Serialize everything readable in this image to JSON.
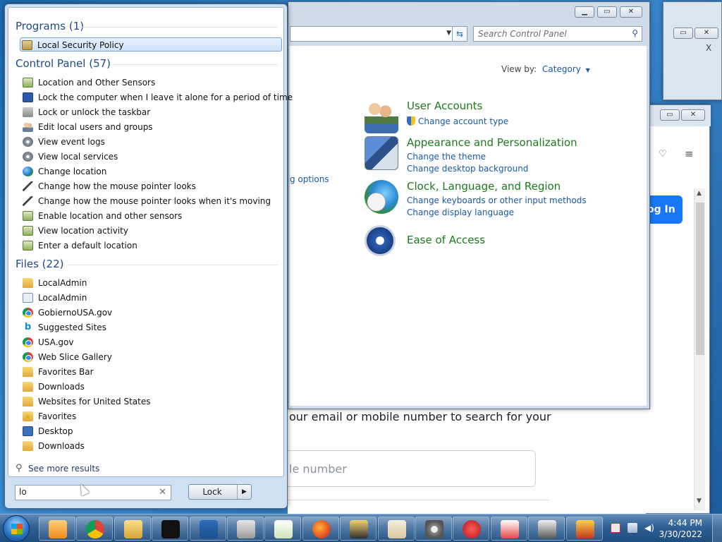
{
  "background_windows": {
    "browser": {
      "lines": [
        "our email or mobile number to search for your"
      ],
      "placeholder": "le number",
      "login_label": "og In"
    }
  },
  "control_panel": {
    "search_placeholder": "Search Control Panel",
    "view_by_label": "View by:",
    "view_by_value": "Category",
    "partial_link": "g options",
    "categories": [
      {
        "title": "User Accounts",
        "links": [
          "Change account type"
        ],
        "icon": "user-accounts-icon"
      },
      {
        "title": "Appearance and Personalization",
        "links": [
          "Change the theme",
          "Change desktop background"
        ],
        "icon": "appearance-icon"
      },
      {
        "title": "Clock, Language, and Region",
        "links": [
          "Change keyboards or other input methods",
          "Change display language"
        ],
        "icon": "clock-globe-icon"
      },
      {
        "title": "Ease of Access",
        "links": [],
        "icon": "ease-of-access-icon"
      }
    ]
  },
  "start_menu": {
    "programs_header": "Programs (1)",
    "programs": [
      {
        "label": "Local Security Policy",
        "icon": "security-policy-icon"
      }
    ],
    "control_panel_header": "Control Panel (57)",
    "control_panel_items": [
      {
        "label": "Location and Other Sensors",
        "icon": "sensors-icon"
      },
      {
        "label": "Lock the computer when I leave it alone for a period of time",
        "icon": "monitor-icon"
      },
      {
        "label": "Lock or unlock the taskbar",
        "icon": "taskbar-icon"
      },
      {
        "label": "Edit local users and groups",
        "icon": "users-icon"
      },
      {
        "label": "View event logs",
        "icon": "event-logs-icon"
      },
      {
        "label": "View local services",
        "icon": "services-icon"
      },
      {
        "label": "Change location",
        "icon": "globe-icon"
      },
      {
        "label": "Change how the mouse pointer looks",
        "icon": "pointer-icon"
      },
      {
        "label": "Change how the mouse pointer looks when it's moving",
        "icon": "pointer-icon"
      },
      {
        "label": "Enable location and other sensors",
        "icon": "sensors-icon"
      },
      {
        "label": "View location activity",
        "icon": "sensors-icon"
      },
      {
        "label": "Enter a default location",
        "icon": "sensors-icon"
      }
    ],
    "files_header": "Files (22)",
    "files": [
      {
        "label": "LocalAdmin",
        "icon": "folder-icon"
      },
      {
        "label": "LocalAdmin",
        "icon": "contact-card-icon"
      },
      {
        "label": "GobiernoUSA.gov",
        "icon": "chrome-icon"
      },
      {
        "label": "Suggested Sites",
        "icon": "bing-icon"
      },
      {
        "label": "USA.gov",
        "icon": "chrome-icon"
      },
      {
        "label": "Web Slice Gallery",
        "icon": "chrome-icon"
      },
      {
        "label": "Favorites Bar",
        "icon": "folder-icon"
      },
      {
        "label": "Downloads",
        "icon": "folder-icon"
      },
      {
        "label": "Websites for United States",
        "icon": "folder-icon"
      },
      {
        "label": "Favorites",
        "icon": "favorites-folder-icon"
      },
      {
        "label": "Desktop",
        "icon": "desktop-icon"
      },
      {
        "label": "Downloads",
        "icon": "folder-icon"
      }
    ],
    "see_more": "See more results",
    "search_value": "lo",
    "power_button_label": "Lock"
  },
  "taskbar": {
    "time": "4:44 PM",
    "date": "3/30/2022",
    "apps": [
      "media-player-icon",
      "chrome-icon",
      "file-explorer-icon",
      "command-prompt-icon",
      "powershell-icon",
      "drive-icon",
      "notepad-icon",
      "firefox-icon",
      "spider-solitaire-icon",
      "mahjong-icon",
      "settings-gear-icon",
      "purble-place-icon",
      "hearts-icon",
      "chess-icon",
      "solitaire-icon"
    ]
  },
  "colors": {
    "accent_link": "#1a5aa6",
    "category_title": "#1e7a1e",
    "section_header": "#1e4a8a",
    "login_button": "#1877f2"
  }
}
